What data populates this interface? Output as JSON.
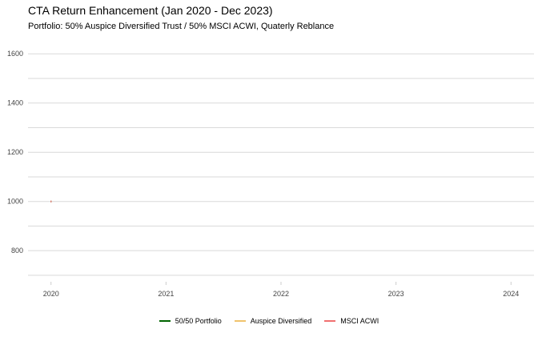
{
  "chart_data": {
    "type": "line",
    "title": "CTA Return Enhancement (Jan 2020 - Dec 2023)",
    "subtitle": "Portfolio: 50% Auspice Diversified Trust / 50% MSCI ACWI, Quaterly Reblance",
    "xlabel": "",
    "ylabel": "",
    "x_ticks": [
      "2020",
      "2021",
      "2022",
      "2023",
      "2024"
    ],
    "y_ticks": [
      800,
      1000,
      1200,
      1400,
      1600
    ],
    "xlim": [
      2019.8,
      2024.2
    ],
    "ylim": [
      690,
      1630
    ],
    "grid": true,
    "legend_position": "bottom",
    "series": [
      {
        "name": "50/50 Portfolio",
        "color": "#006400",
        "points": [
          [
            2020.0,
            1000
          ]
        ]
      },
      {
        "name": "Auspice Diversified",
        "color": "#f0c36d",
        "points": [
          [
            2020.0,
            1000
          ]
        ]
      },
      {
        "name": "MSCI ACWI",
        "color": "#f07070",
        "points": [
          [
            2020.0,
            1000
          ]
        ]
      }
    ]
  }
}
